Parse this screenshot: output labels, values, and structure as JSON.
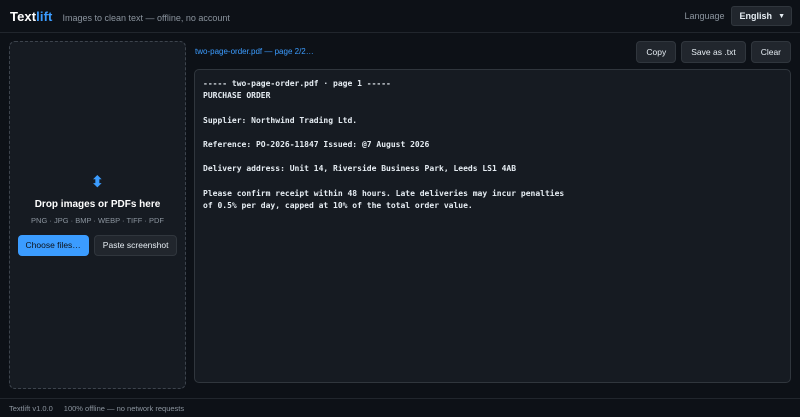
{
  "header": {
    "logo_main": "Text",
    "logo_accent": "lift",
    "tagline": "Images to clean text — offline, no account",
    "language_label": "Language",
    "language_value": "English"
  },
  "dropzone": {
    "icon": "upload-arrows-icon",
    "title": "Drop images or PDFs here",
    "formats": "PNG · JPG · BMP · WEBP · TIFF · PDF",
    "choose_label": "Choose files…",
    "paste_label": "Paste screenshot"
  },
  "editor": {
    "file_label": "two-page-order.pdf — page 2/2…",
    "copy_label": "Copy",
    "save_label": "Save as .txt",
    "clear_label": "Clear",
    "text": "----- two-page-order.pdf · page 1 -----\nPURCHASE ORDER\n\nSupplier: Northwind Trading Ltd.\n\nReference: PO-2026-11847 Issued: @7 August 2026\n\nDelivery address: Unit 14, Riverside Business Park, Leeds LS1 4AB\n\nPlease confirm receipt within 48 hours. Late deliveries may incur penalties\nof 0.5% per day, capped at 10% of the total order value."
  },
  "footer": {
    "version": "Textlift v1.0.0",
    "status": "100% offline — no network requests"
  },
  "colors": {
    "accent": "#3b9cff",
    "background": "#0d1117",
    "panel": "#161b22"
  }
}
